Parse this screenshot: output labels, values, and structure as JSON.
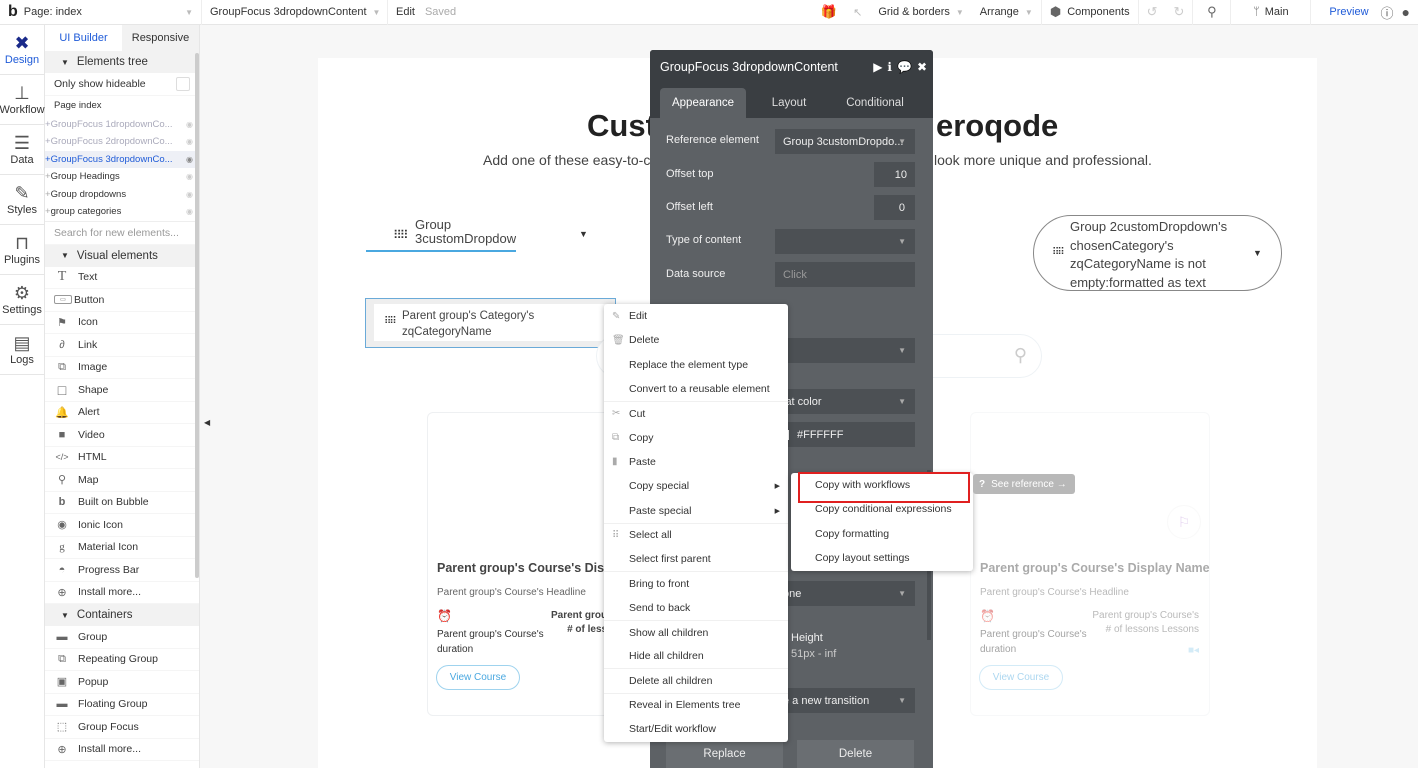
{
  "topbar": {
    "logo": "b",
    "page_label": "Page: index",
    "element_selector": "GroupFocus 3dropdownContent",
    "edit_label": "Edit",
    "saved_label": "Saved",
    "grid_borders": "Grid & borders",
    "arrange": "Arrange",
    "components": "Components",
    "branch": "Main",
    "preview": "Preview"
  },
  "rail": [
    {
      "label": "Design",
      "icon": "design-icon",
      "active": true
    },
    {
      "label": "Workflow",
      "icon": "workflow-icon"
    },
    {
      "label": "Data",
      "icon": "data-icon"
    },
    {
      "label": "Styles",
      "icon": "styles-icon"
    },
    {
      "label": "Plugins",
      "icon": "plugins-icon"
    },
    {
      "label": "Settings",
      "icon": "settings-icon"
    },
    {
      "label": "Logs",
      "icon": "logs-icon"
    }
  ],
  "panel": {
    "tabs": [
      "UI Builder",
      "Responsive"
    ],
    "elements_tree": "Elements tree",
    "only_show_hideable": "Only show hideable",
    "page_index": "Page index",
    "tree": [
      {
        "label": "GroupFocus 1dropdownCo...",
        "state": "dim"
      },
      {
        "label": "GroupFocus 2dropdownCo...",
        "state": "dim"
      },
      {
        "label": "GroupFocus 3dropdownCo...",
        "state": "selected"
      },
      {
        "label": "Group Headings",
        "state": "normal"
      },
      {
        "label": "Group dropdowns",
        "state": "normal"
      },
      {
        "label": "group categories",
        "state": "normal"
      }
    ],
    "search_placeholder": "Search for new elements...",
    "visual_elements": "Visual elements",
    "visual": [
      "Text",
      "Button",
      "Icon",
      "Link",
      "Image",
      "Shape",
      "Alert",
      "Video",
      "HTML",
      "Map",
      "Built on Bubble",
      "Ionic Icon",
      "Material Icon",
      "Progress Bar",
      "Install more..."
    ],
    "containers": "Containers",
    "container_items": [
      "Group",
      "Repeating Group",
      "Popup",
      "Floating Group",
      "Group Focus",
      "Install more..."
    ]
  },
  "canvas": {
    "heading_left": "Cust",
    "heading_right": "eroqode",
    "sub_left": "Add one of these easy-to-c",
    "sub_right": "look more unique and professional.",
    "dropdown1_line1": "Group",
    "dropdown1_line2": "3customDropdown",
    "selected_line1": "Parent group's Category's",
    "selected_line2": "zqCategoryName",
    "dropdown3": [
      "Group 2customDropdown's",
      "chosenCategory's",
      "zqCategoryName is not",
      "empty:formatted as text"
    ],
    "card_left": {
      "title": "Parent group's Course's Displa",
      "headline": "Parent group's Course's Headline",
      "duration": "Parent group's Course's duration",
      "lessons_line1": "Parent group",
      "lessons_line2": "# of lesso",
      "button": "View Course"
    },
    "card_right": {
      "title": "Parent group's Course's Display Name",
      "headline": "Parent group's Course's Headline",
      "duration": "Parent group's Course's duration",
      "lessons_line1": "Parent group's Course's",
      "lessons_line2": "# of lessons  Lessons",
      "button": "View Course"
    }
  },
  "property_editor": {
    "title": "GroupFocus 3dropdownContent",
    "tabs": [
      "Appearance",
      "Layout",
      "Conditional"
    ],
    "reference_element_label": "Reference element",
    "reference_element_value": "Group 3customDropdo...",
    "offset_top_label": "Offset top",
    "offset_top_value": "10",
    "offset_left_label": "Offset left",
    "offset_left_value": "0",
    "type_of_content_label": "Type of content",
    "type_of_content_value": "",
    "data_source_label": "Data source",
    "data_source_placeholder": "Click",
    "bg_style_partial": "lat color",
    "bg_color": "#FFFFFF",
    "border_partial": "one",
    "height_label": "Height",
    "height_value": "51px - inf",
    "transition_partial": "e a new transition",
    "replace_button": "Replace",
    "delete_button": "Delete"
  },
  "context_menu": {
    "items": [
      {
        "label": "Edit",
        "icon": "edit-icon"
      },
      {
        "label": "Delete",
        "icon": "trash-icon"
      },
      {
        "label": "Replace the element type"
      },
      {
        "label": "Convert to a reusable element"
      },
      {
        "label": "Cut",
        "icon": "scissors-icon",
        "sep": true
      },
      {
        "label": "Copy",
        "icon": "copy-icon"
      },
      {
        "label": "Paste",
        "icon": "paste-icon"
      },
      {
        "label": "Copy special",
        "submenu": true
      },
      {
        "label": "Paste special",
        "submenu": true
      },
      {
        "label": "Select all",
        "icon": "grid-icon",
        "sep": true
      },
      {
        "label": "Select first parent"
      },
      {
        "label": "Bring to front",
        "sep": true
      },
      {
        "label": "Send to back"
      },
      {
        "label": "Show all children",
        "sep": true
      },
      {
        "label": "Hide all children"
      },
      {
        "label": "Delete all children",
        "sep": true
      },
      {
        "label": "Reveal in Elements tree",
        "sep": true
      },
      {
        "label": "Start/Edit workflow"
      }
    ],
    "copy_special_submenu": [
      "Copy with workflows",
      "Copy conditional expressions",
      "Copy formatting",
      "Copy layout settings"
    ],
    "highlighted": "Copy with workflows",
    "see_reference": "See reference →"
  },
  "colors": {
    "accent": "#1f5bd8",
    "highlight_box": "#e02020",
    "editor_bg": "#5d6165",
    "editor_header": "#3a3e42"
  }
}
